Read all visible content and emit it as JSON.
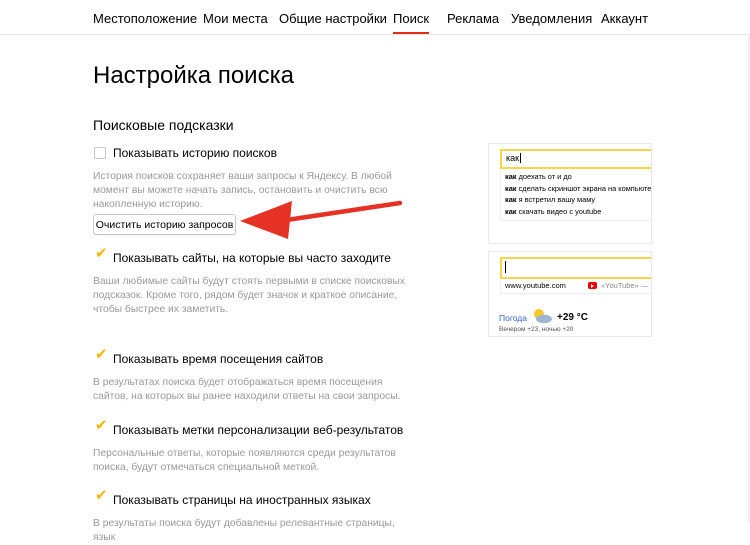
{
  "nav": {
    "items": [
      {
        "label": "Местоположение",
        "active": false
      },
      {
        "label": "Мои места",
        "active": false
      },
      {
        "label": "Общие настройки",
        "active": false
      },
      {
        "label": "Поиск",
        "active": true
      },
      {
        "label": "Реклама",
        "active": false
      },
      {
        "label": "Уведомления",
        "active": false
      },
      {
        "label": "Аккаунт",
        "active": false
      }
    ],
    "accent_color": "#e62c19"
  },
  "page": {
    "title": "Настройка поиска",
    "section_title": "Поисковые подсказки"
  },
  "options": [
    {
      "label": "Показывать историю поисков",
      "checked": false,
      "description": "История поисков сохраняет ваши запросы к Яндексу. В любой момент вы можете начать запись, остановить и очистить всю накопленную историю."
    },
    {
      "label": "Показывать сайты, на которые вы часто заходите",
      "checked": true,
      "description": "Ваши любимые сайты будут стоять первыми в списке поисковых подсказок. Кроме того, рядом будет значок и краткое описание, чтобы быстрее их заметить."
    },
    {
      "label": "Показывать время посещения сайтов",
      "checked": true,
      "description": "В результатах поиска будет отображаться время посещения сайтов, на которых вы ранее находили ответы на свои запросы."
    },
    {
      "label": "Показывать метки персонализации веб-результатов",
      "checked": true,
      "description": "Персональные ответы, которые появляются среди результатов поиска, будут отмечаться специальной меткой."
    },
    {
      "label": "Показывать страницы на иностранных языках",
      "checked": true,
      "description": "В результаты поиска будут добавлены релевантные страницы, язык"
    }
  ],
  "clear_history_button": "Очистить историю запросов",
  "checkmark_color": "#f4b400",
  "preview_history": {
    "query": "как",
    "suggestions": [
      {
        "bold": "как",
        "rest": " доехать от и до"
      },
      {
        "bold": "как",
        "rest": " сделать скриншот экрана на компьютере"
      },
      {
        "bold": "как",
        "rest": " я встретил вашу маму"
      },
      {
        "bold": "как",
        "rest": " скачать видео с youtube"
      }
    ]
  },
  "preview_sites": {
    "site_url": "www.youtube.com",
    "site_name": "«YouTube» —",
    "weather_label": "Погода",
    "weather_temp": "+29 °C",
    "weather_sub": "Вечером +23,   ночью +20"
  },
  "icons": {
    "arrow": "red-arrow-pointer-icon",
    "weather": "partly-cloudy-icon",
    "youtube": "youtube-icon",
    "checkbox": "checkbox-icon"
  }
}
